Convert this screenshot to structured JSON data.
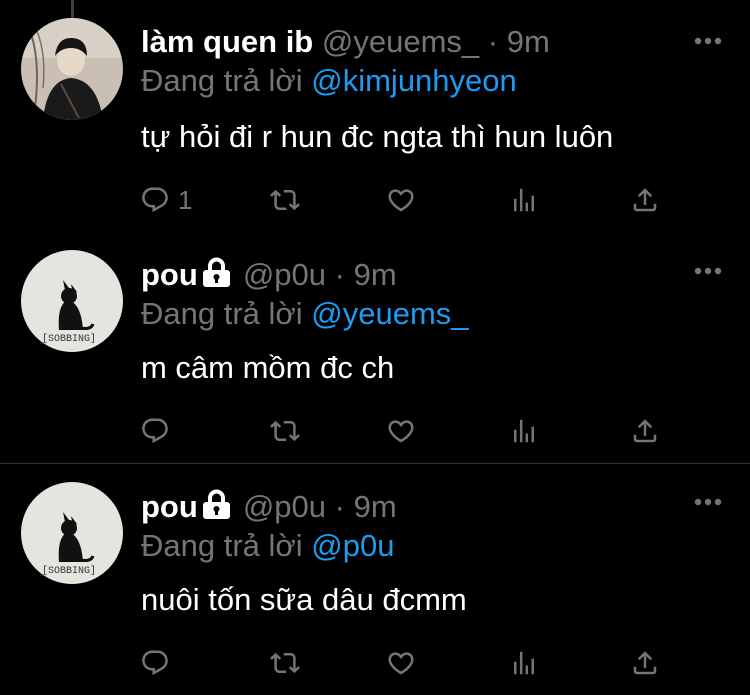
{
  "tweets": [
    {
      "name": "làm quen ib",
      "handle": "@yeuems_",
      "dot": "·",
      "time": "9m",
      "replying_prefix": "Đang trả lời",
      "replying_to": "@kimjunhyeon",
      "text": "tự hỏi đi r hun đc ngta thì hun luôn",
      "reply_count": "1",
      "locked": false,
      "avatar_icon": "person-photo-icon"
    },
    {
      "name": "pou",
      "handle": "@p0u",
      "dot": "·",
      "time": "9m",
      "replying_prefix": "Đang trả lời",
      "replying_to": "@yeuems_",
      "text": "m câm mồm đc ch",
      "reply_count": "",
      "locked": true,
      "avatar_caption": "[SOBBING]",
      "avatar_icon": "black-cat-icon"
    },
    {
      "name": "pou",
      "handle": "@p0u",
      "dot": "·",
      "time": "9m",
      "replying_prefix": "Đang trả lời",
      "replying_to": "@p0u",
      "text": "nuôi tốn sữa dâu đcmm",
      "reply_count": "",
      "locked": true,
      "avatar_caption": "[SOBBING]",
      "avatar_icon": "black-cat-icon"
    }
  ],
  "colors": {
    "background": "#000000",
    "text": "#ffffff",
    "secondary": "#71767b",
    "link": "#1d9bf0",
    "divider": "#2f3336"
  },
  "icons": [
    "reply-icon",
    "retweet-icon",
    "like-icon",
    "analytics-icon",
    "share-icon",
    "more-icon",
    "lock-icon"
  ]
}
